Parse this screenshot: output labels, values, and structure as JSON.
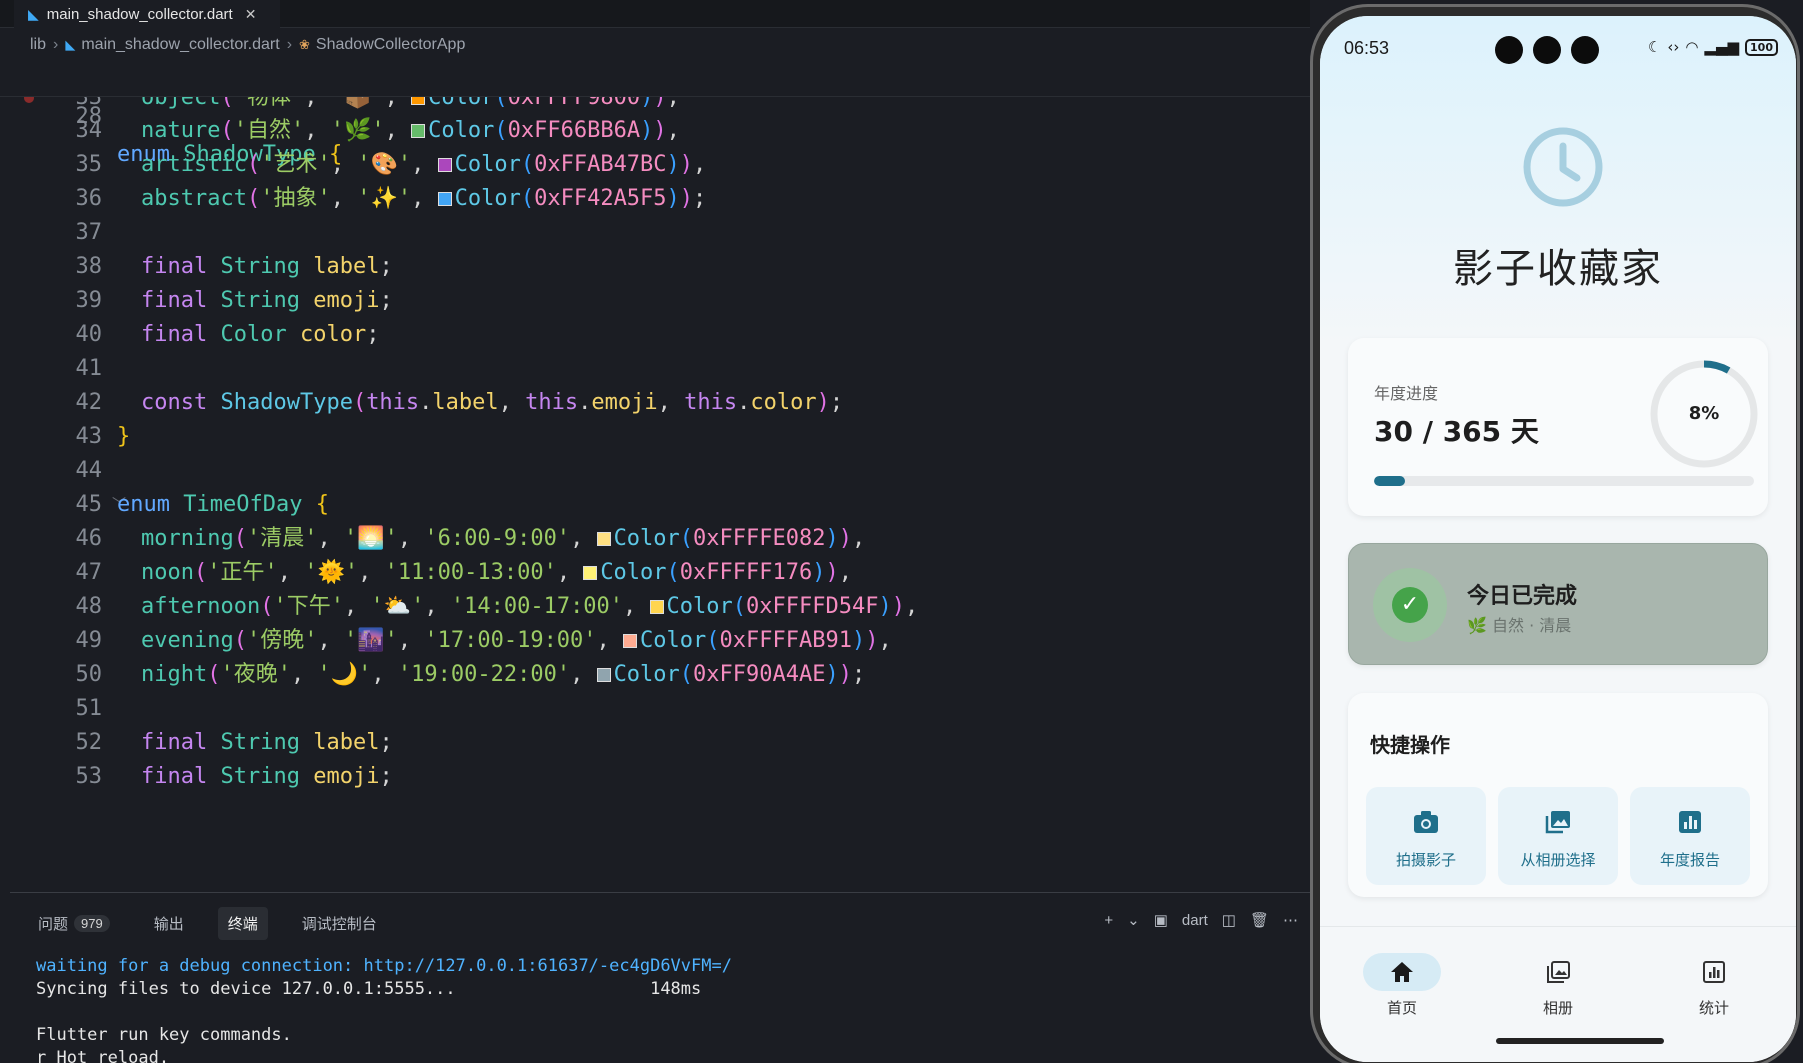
{
  "editor": {
    "tab_label": "main_shadow_collector.dart",
    "breadcrumb": [
      "lib",
      "main_shadow_collector.dart",
      "ShadowCollectorApp"
    ],
    "sticky": {
      "line_no": "28",
      "text": "enum ShadowType {"
    },
    "lines": [
      {
        "n": "33"
      },
      {
        "n": "34"
      },
      {
        "n": "35"
      },
      {
        "n": "36"
      },
      {
        "n": "37"
      },
      {
        "n": "38"
      },
      {
        "n": "39"
      },
      {
        "n": "40"
      },
      {
        "n": "41"
      },
      {
        "n": "42"
      },
      {
        "n": "43"
      },
      {
        "n": "44"
      },
      {
        "n": "45"
      },
      {
        "n": "46"
      },
      {
        "n": "47"
      },
      {
        "n": "48"
      },
      {
        "n": "49"
      },
      {
        "n": "50"
      },
      {
        "n": "51"
      },
      {
        "n": "52"
      },
      {
        "n": "53"
      }
    ],
    "swatch_colors": {
      "object": "#FF9800",
      "nature": "#66BB6A",
      "artistic": "#AB47BC",
      "abstract": "#42A5F5",
      "morning": "#FFE082",
      "noon": "#FFF176",
      "afternoon": "#FFD54F",
      "evening": "#FFAB91",
      "night": "#90A4AE"
    }
  },
  "panel": {
    "tabs": [
      {
        "label": "问题",
        "badge": "979"
      },
      {
        "label": "输出"
      },
      {
        "label": "终端"
      },
      {
        "label": "调试控制台"
      }
    ],
    "actions": {
      "add": "+",
      "shell": "dart"
    },
    "terminal": {
      "line1_prefix": "waiting for a debug connection: ",
      "line1_url": "http://127.0.0.1:61637/-ec4gD6VvFM=/",
      "line2": "Syncing files to device 127.0.0.1:5555...                   148ms",
      "line3": "",
      "line4": "Flutter run key commands.",
      "line5": "r Hot reload."
    }
  },
  "phone": {
    "status": {
      "time": "06:53",
      "battery": "100"
    },
    "app_title": "影子收藏家",
    "progress": {
      "label": "年度进度",
      "value": "30 / 365 天",
      "percent_label": "8%",
      "fraction": 0.082
    },
    "done": {
      "title": "今日已完成",
      "subtitle": "🌿 自然 · 清晨"
    },
    "quick": {
      "title": "快捷操作",
      "buttons": [
        {
          "label": "拍摄影子",
          "icon": "camera-icon"
        },
        {
          "label": "从相册选择",
          "icon": "photo-library-icon"
        },
        {
          "label": "年度报告",
          "icon": "bar-chart-icon"
        }
      ]
    },
    "nav": [
      {
        "label": "首页",
        "icon": "home-icon"
      },
      {
        "label": "相册",
        "icon": "album-icon"
      },
      {
        "label": "统计",
        "icon": "stats-icon"
      }
    ],
    "accent_color": "#1F6F8B"
  }
}
